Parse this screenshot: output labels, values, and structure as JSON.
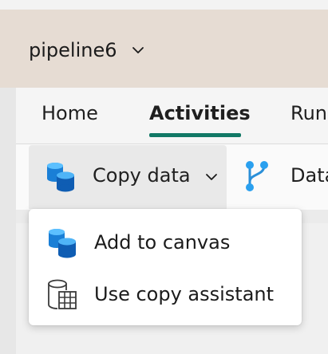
{
  "header": {
    "pipeline_name": "pipeline6",
    "dropdown_icon": "chevron-down-icon"
  },
  "tabs": [
    {
      "label": "Home",
      "active": false
    },
    {
      "label": "Activities",
      "active": true
    },
    {
      "label": "Run",
      "active": false
    }
  ],
  "toolbar": {
    "copy_data": {
      "label": "Copy data",
      "icon": "copy-data-icon",
      "dropdown_icon": "chevron-down-icon"
    },
    "next_item": {
      "label": "Data",
      "icon": "data-branch-icon"
    }
  },
  "copy_menu": {
    "items": [
      {
        "label": "Add to canvas",
        "icon": "copy-data-icon"
      },
      {
        "label": "Use copy assistant",
        "icon": "copy-assistant-icon"
      }
    ]
  },
  "colors": {
    "accent_teal": "#117865",
    "header_bg": "#e6dcd3",
    "icon_blue_dark": "#0f5db3",
    "icon_blue_light": "#2aa0ef"
  }
}
